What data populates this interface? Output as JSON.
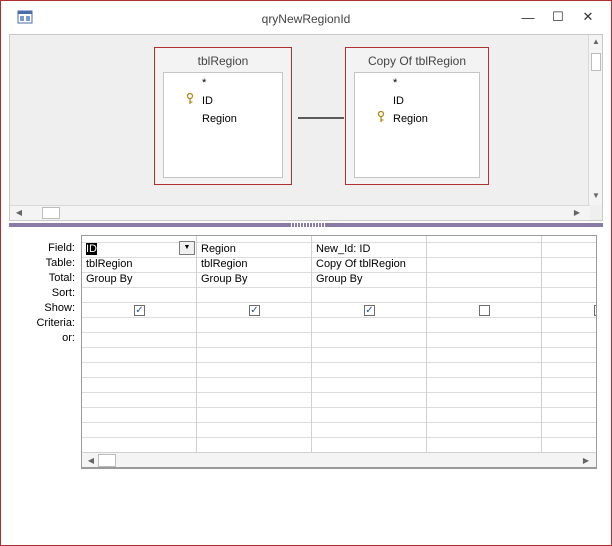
{
  "window": {
    "title": "qryNewRegionId",
    "controls": {
      "minimize": "—",
      "maximize": "☐",
      "close": "✕"
    }
  },
  "tables": [
    {
      "title": "tblRegion",
      "fields": [
        {
          "name": "*",
          "key": false
        },
        {
          "name": "ID",
          "key": true
        },
        {
          "name": "Region",
          "key": false
        }
      ]
    },
    {
      "title": "Copy Of tblRegion",
      "fields": [
        {
          "name": "*",
          "key": false
        },
        {
          "name": "ID",
          "key": false
        },
        {
          "name": "Region",
          "key": true
        }
      ]
    }
  ],
  "grid": {
    "row_labels": [
      "Field:",
      "Table:",
      "Total:",
      "Sort:",
      "Show:",
      "Criteria:",
      "or:"
    ],
    "columns": [
      {
        "field": "ID",
        "table": "tblRegion",
        "total": "Group By",
        "show": true
      },
      {
        "field": "Region",
        "table": "tblRegion",
        "total": "Group By",
        "show": true
      },
      {
        "field": "New_Id: ID",
        "table": "Copy Of tblRegion",
        "total": "Group By",
        "show": true
      },
      {
        "field": "",
        "table": "",
        "total": "",
        "show": false
      }
    ]
  },
  "icons": {
    "app": "query-design-icon",
    "key": "primary-key-icon",
    "dropdown": "dropdown-arrow-icon"
  },
  "colors": {
    "accent": "#b0302f",
    "splitter": "#8a7aa6",
    "check": "#2b4fa0"
  }
}
